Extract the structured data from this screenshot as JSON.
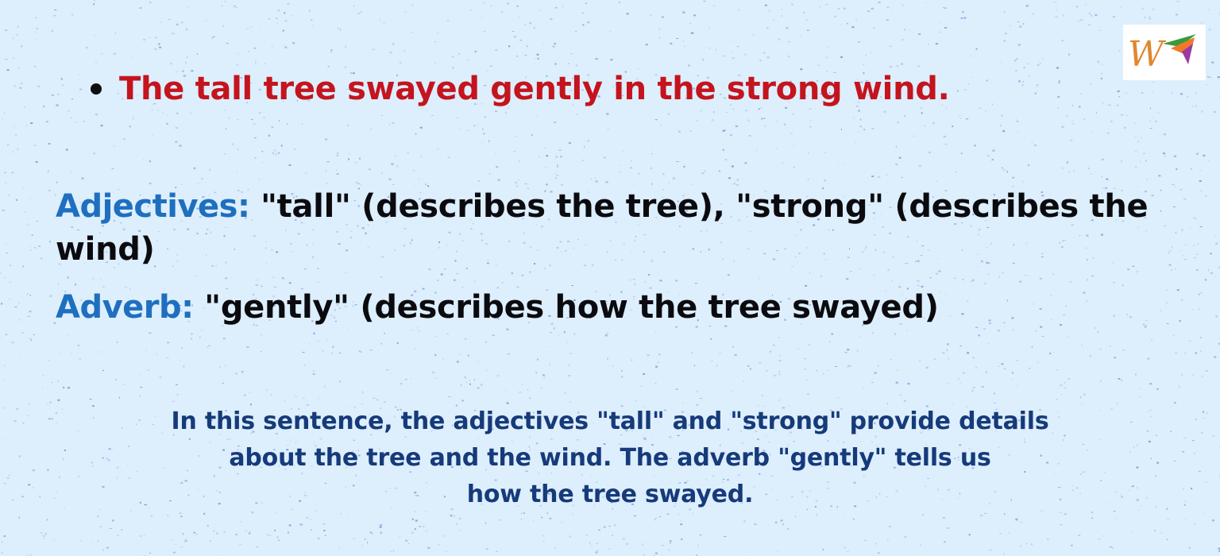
{
  "logo": {
    "letter": "W",
    "colors": {
      "letter": "#e0872e",
      "flag_green": "#3a9a3a",
      "flag_orange": "#ee7a2a",
      "flag_purple": "#9b3aa0"
    }
  },
  "example": {
    "bullet_icon": "bullet-dot",
    "sentence": "The tall tree swayed gently in the strong wind."
  },
  "explanations": {
    "adjectives": {
      "term": "Adjectives:",
      "text": " \"tall\" (describes the tree), \"strong\" (describes the wind)"
    },
    "adverb": {
      "term": "Adverb:",
      "text": " \"gently\" (describes how the tree swayed)"
    }
  },
  "summary": {
    "line1": "In this sentence, the adjectives \"tall\" and \"strong\" provide details",
    "line2": "about the tree and the wind. The adverb \"gently\" tells us",
    "line3": "how the tree swayed."
  },
  "colors": {
    "background": "#ddeefc",
    "speckle": "#3f6fc8",
    "sentence": "#c4141e",
    "term": "#1e6fbf",
    "body_text": "#0b0b0f",
    "summary": "#163a7a"
  }
}
